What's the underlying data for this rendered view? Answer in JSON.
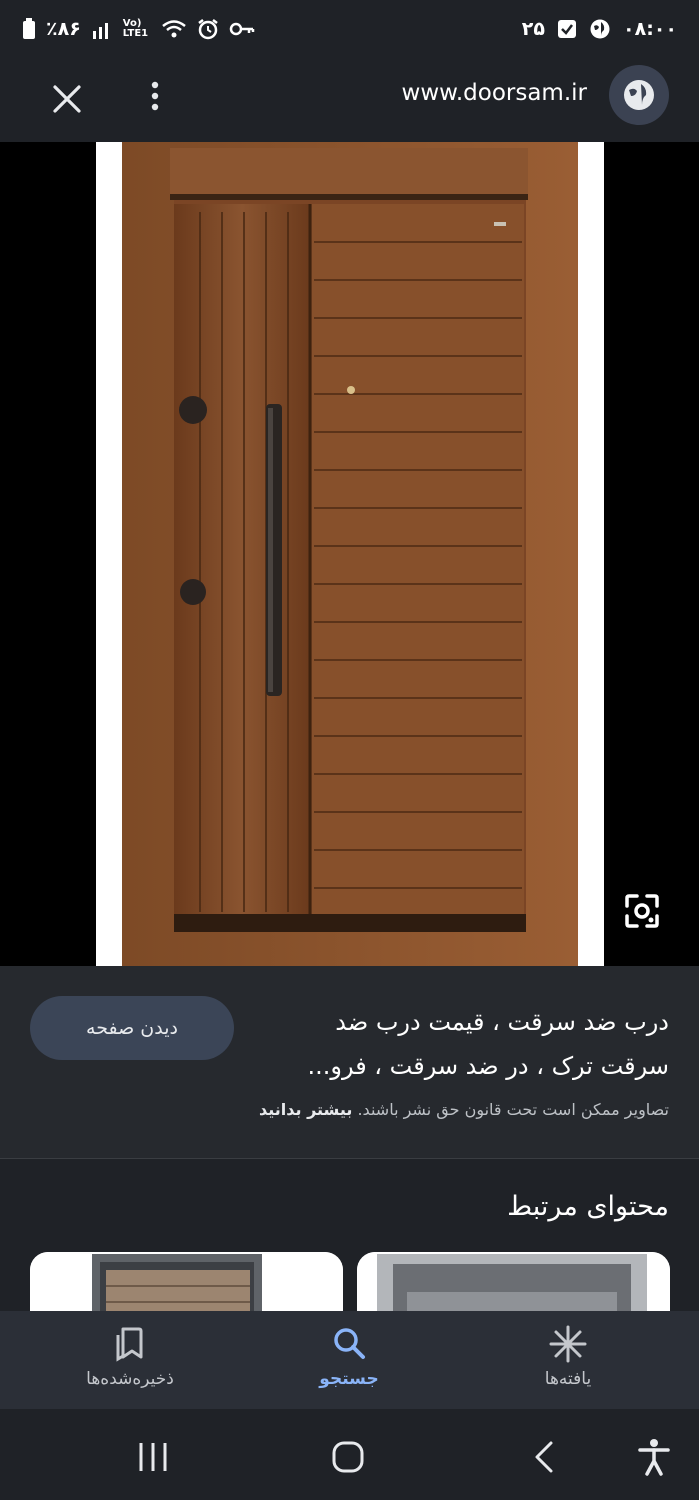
{
  "status_bar": {
    "battery": "٪۸۶",
    "network": "Vo) LTE1",
    "date": "۲۵",
    "time": "۰۸:۰۰",
    "icons": [
      "battery-icon",
      "signal-icon",
      "wifi-icon",
      "alarm-icon",
      "key-icon",
      "checkbox-icon",
      "globe-small-icon"
    ]
  },
  "top_bar": {
    "url": "www.doorsam.ir"
  },
  "result": {
    "title": "درب ضد سرقت ، قیمت درب ضد سرقت ترک ، در ضد سرقت ، فرو...",
    "visit_label": "دیدن صفحه",
    "copyright_note": "تصاویر ممکن است تحت قانون حق نشر باشند.",
    "learn_more": "بیشتر بدانید"
  },
  "related": {
    "title": "محتوای مرتبط"
  },
  "bottom_nav": {
    "items": [
      {
        "label": "ذخیره‌شده‌ها",
        "icon": "bookmark-icon"
      },
      {
        "label": "جستجو",
        "icon": "search-icon"
      },
      {
        "label": "یافته‌ها",
        "icon": "asterisk-icon"
      }
    ],
    "active": "جستجو"
  },
  "colors": {
    "background": "#1f2227",
    "accent": "#8ab4f8",
    "door_wood": "#7a4624"
  }
}
